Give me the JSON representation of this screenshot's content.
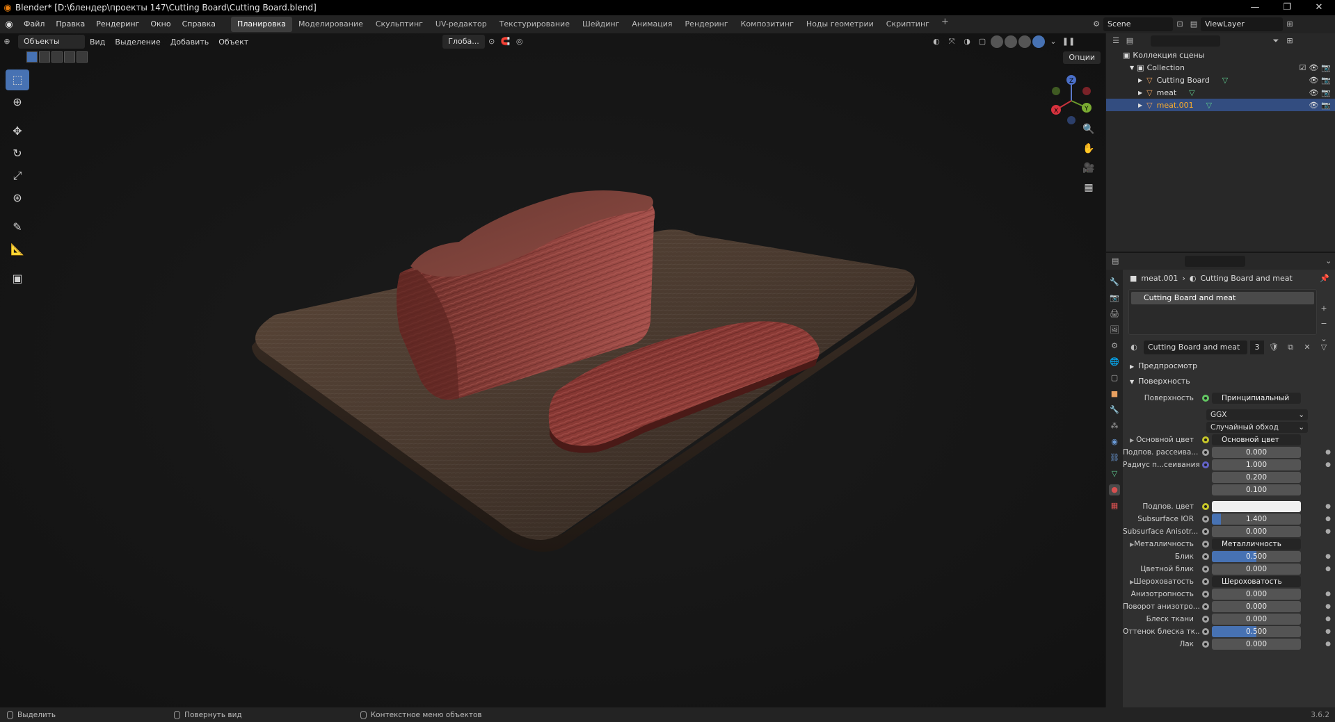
{
  "window": {
    "title": "Blender* [D:\\блендер\\проекты 147\\Cutting Board\\Cutting Board.blend]",
    "controls": [
      "—",
      "❐",
      "✕"
    ]
  },
  "menu": [
    "Файл",
    "Правка",
    "Рендеринг",
    "Окно",
    "Справка"
  ],
  "workspaces": {
    "tabs": [
      "Планировка",
      "Моделирование",
      "Скульптинг",
      "UV-редактор",
      "Текстурирование",
      "Шейдинг",
      "Анимация",
      "Рендеринг",
      "Композитинг",
      "Ноды геометрии",
      "Скриптинг"
    ],
    "active": "Планировка",
    "add": "+"
  },
  "scene": {
    "name": "Scene",
    "view_layer": "ViewLayer"
  },
  "viewport": {
    "mode": "Объекты",
    "menus": [
      "Вид",
      "Выделение",
      "Добавить",
      "Объект"
    ],
    "orientation": "Глоба...",
    "options": "Опции"
  },
  "outliner": {
    "root": "Коллекция сцены",
    "collection": "Collection",
    "objects": [
      {
        "name": "Cutting Board",
        "selected": false
      },
      {
        "name": "meat",
        "selected": false
      },
      {
        "name": "meat.001",
        "selected": true
      }
    ]
  },
  "properties": {
    "object": "meat.001",
    "material": "Cutting Board and meat",
    "slot": "Cutting Board and meat",
    "users": "3",
    "panels": {
      "preview": "Предпросмотр",
      "surface": "Поверхность"
    },
    "surface_label": "Поверхность",
    "surface_value": "Принципиальный BSDF",
    "distribution": "GGX",
    "subsurface_method": "Случайный обход",
    "rows": {
      "base_color": {
        "label": "Основной цвет",
        "value": "Основной цвет"
      },
      "subsurface": {
        "label": "Подпов. рассеива...",
        "value": "0.000"
      },
      "subsurface_radius": {
        "label": "Радиус п...сеивания",
        "v1": "1.000",
        "v2": "0.200",
        "v3": "0.100"
      },
      "subsurface_color": {
        "label": "Подпов. цвет",
        "color": "#f0f0f0"
      },
      "subsurface_ior": {
        "label": "Subsurface IOR",
        "value": "1.400",
        "fill": 0.1
      },
      "subsurface_aniso": {
        "label": "Subsurface Anisotr...",
        "value": "0.000"
      },
      "metallic": {
        "label": "Металличность",
        "value": "Металличность"
      },
      "specular": {
        "label": "Блик",
        "value": "0.500",
        "fill": 0.5
      },
      "specular_tint": {
        "label": "Цветной блик",
        "value": "0.000"
      },
      "roughness": {
        "label": "Шероховатость",
        "value": "Шероховатость"
      },
      "anisotropic": {
        "label": "Анизотропность",
        "value": "0.000"
      },
      "aniso_rotation": {
        "label": "Поворот анизотро...",
        "value": "0.000"
      },
      "sheen": {
        "label": "Блеск ткани",
        "value": "0.000"
      },
      "sheen_tint": {
        "label": "Оттенок блеска тк...",
        "value": "0.500",
        "fill": 0.5
      },
      "clearcoat": {
        "label": "Лак",
        "value": "0.000"
      }
    }
  },
  "statusbar": {
    "items": [
      "Выделить",
      "Повернуть вид",
      "Контекстное меню объектов"
    ],
    "version": "3.6.2"
  },
  "colors": {
    "accent": "#4772b3",
    "selected_row": "#334d80",
    "brand": "#e87d0d"
  }
}
